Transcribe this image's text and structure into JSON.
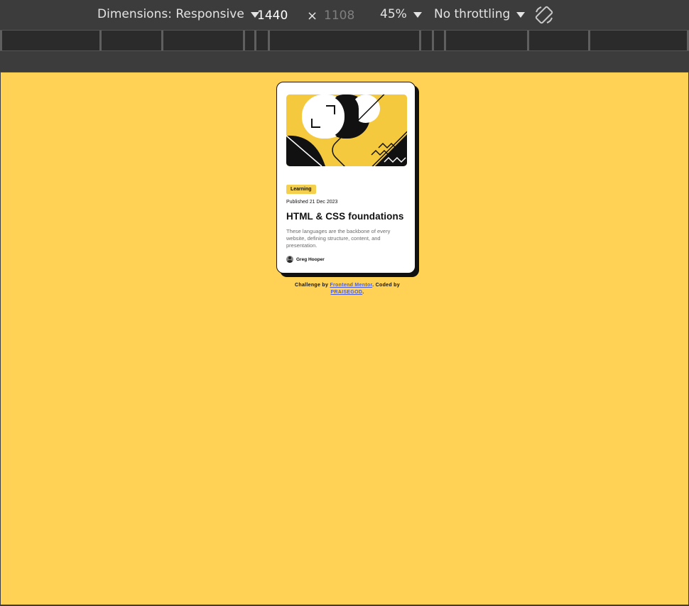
{
  "toolbar": {
    "dimensions_label": "Dimensions: Responsive",
    "width_value": "1440",
    "times_sign": "×",
    "height_placeholder": "1108",
    "zoom_value": "45%",
    "throttle_value": "No throttling",
    "rotate_icon": "rotate-icon"
  },
  "card": {
    "image_icon": "illustration-article",
    "category": "Learning",
    "published": "Published 21 Dec 2023",
    "title": "HTML & CSS foundations",
    "description": "These languages are the backbone of every website, defining structure, content, and presentation.",
    "author": "Greg Hooper"
  },
  "attribution": {
    "prefix": "Challenge by ",
    "link1": "Frontend Mentor",
    "middle": ". Coded by ",
    "link2": "PRAISEGOD",
    "suffix": "."
  },
  "colors": {
    "page_background": "#ffd154",
    "badge": "#f4d04e",
    "link": "#4c5fd5"
  }
}
